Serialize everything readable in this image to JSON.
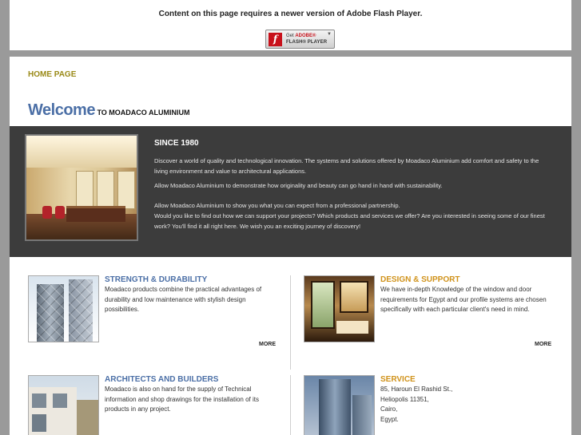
{
  "flash": {
    "message": "Content on this page requires a newer version of Adobe Flash Player.",
    "button_get": "Get",
    "button_brand": "ADOBE®",
    "button_product": "FLASH® PLAYER",
    "logo_glyph": "f"
  },
  "nav": {
    "home": "HOME PAGE"
  },
  "welcome": {
    "big": "Welcome",
    "small": " TO MOADACO ALUMINIUM"
  },
  "intro": {
    "heading": "SINCE 1980",
    "para1": "Discover a world of quality and technological innovation. The systems and solutions offered by Moadaco Aluminium add comfort and safety to the living environment and value to architectural applications.",
    "para2": "Allow Moadaco Aluminium to demonstrate how originality and beauty can go hand in hand with sustainability.",
    "para3": "Allow Moadaco Aluminium to show you what you can expect from a professional partnership.",
    "para4": "Would you like to find out how we can support your projects? Which products and services we offer? Are you interested in seeing some of our finest work? You'll find it all right here. We wish you an exciting journey of discovery!"
  },
  "features": [
    {
      "title": "STRENGTH & DURABILITY",
      "body": "Moadaco products combine the practical advantages of durability and low maintenance with stylish design possibilities.",
      "more": "MORE"
    },
    {
      "title": "DESIGN & SUPPORT",
      "body": "We have in-depth Knowledge of the window and door requirements for Egypt and our profile systems are chosen specifically with each particular client's need in mind.",
      "more": "MORE"
    },
    {
      "title": "ARCHITECTS AND BUILDERS",
      "body": "Moadaco is also on hand for the supply of Technical information and shop drawings for the installation of its products in any project."
    },
    {
      "title": "SERVICE",
      "address": [
        "85, Haroun El Rashid St.,",
        "Heliopolis 11351,",
        "Cairo,",
        "Egypt."
      ]
    }
  ],
  "colors": {
    "accent_blue": "#4b6fa6",
    "accent_gold": "#9a8a18",
    "accent_orange": "#d0921a",
    "dark_band": "#3c3c3c"
  }
}
